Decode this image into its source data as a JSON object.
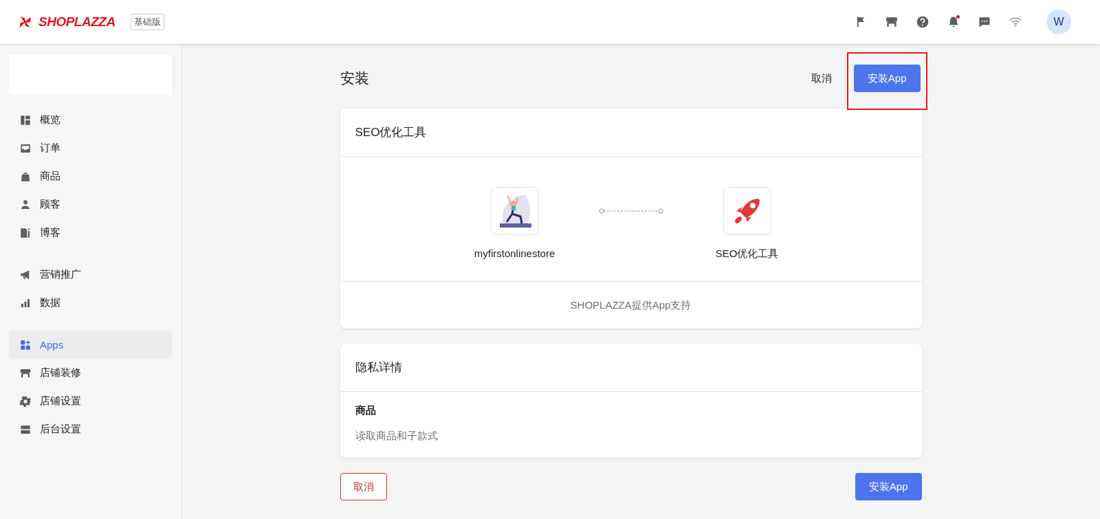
{
  "header": {
    "logo": "SHOPLAZZA",
    "plan_badge": "基础版",
    "avatar": "W",
    "notification_dot": true
  },
  "sidebar": {
    "groups": [
      [
        {
          "label": "概览",
          "selected": false
        },
        {
          "label": "订单",
          "selected": false
        },
        {
          "label": "商品",
          "selected": false
        },
        {
          "label": "顾客",
          "selected": false
        },
        {
          "label": "博客",
          "selected": false
        }
      ],
      [
        {
          "label": "营销推广",
          "selected": false
        },
        {
          "label": "数据",
          "selected": false
        }
      ],
      [
        {
          "label": "Apps",
          "selected": true
        },
        {
          "label": "店铺装修",
          "selected": false
        },
        {
          "label": "店铺设置",
          "selected": false
        },
        {
          "label": "后台设置",
          "selected": false
        }
      ]
    ]
  },
  "page": {
    "title": "安装",
    "cancel": "取消",
    "install": "安装App",
    "install_highlighted": true
  },
  "app_card": {
    "title": "SEO优化工具",
    "store_name": "myfirstonlinestore",
    "app_name": "SEO优化工具",
    "footer": "SHOPLAZZA提供App支持"
  },
  "privacy_card": {
    "title": "隐私详情",
    "items": [
      {
        "heading": "商品",
        "description": "读取商品和子款式"
      }
    ]
  },
  "footer_buttons": {
    "cancel": "取消",
    "install": "安装App"
  }
}
